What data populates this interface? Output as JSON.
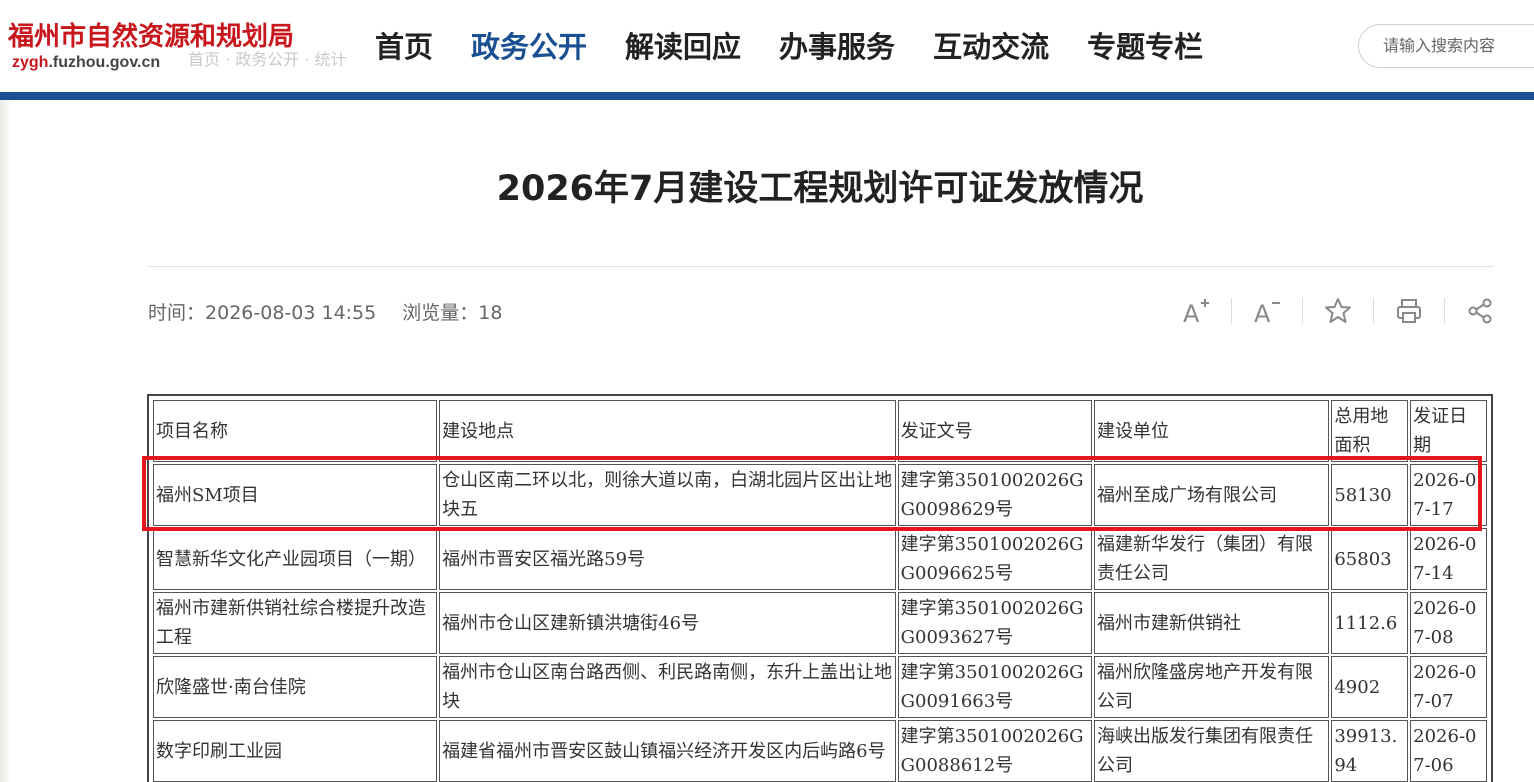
{
  "site": {
    "logo_cn": "福州市自然资源和规划局",
    "logo_en_prefix": "zygh",
    "logo_en_suffix": ".fuzhou.gov.cn",
    "breadcrumb_ghost": "首页 · 政务公开 · 统计"
  },
  "nav": {
    "items": [
      "首页",
      "政务公开",
      "解读回应",
      "办事服务",
      "互动交流",
      "专题专栏"
    ],
    "active_index": 1
  },
  "search": {
    "placeholder": "请输入搜索内容"
  },
  "article": {
    "title": "2026年7月建设工程规划许可证发放情况",
    "time_label": "时间：",
    "time_value": "2026-08-03 14:55",
    "views_label": "浏览量：",
    "views_value": "18"
  },
  "tools": {
    "icons": [
      "font-increase-icon",
      "font-decrease-icon",
      "star-icon",
      "print-icon",
      "share-icon"
    ]
  },
  "colors": {
    "brand_red": "#c8161d",
    "brand_blue": "#1a4f92",
    "highlight": "#e3161e"
  },
  "table": {
    "headers": [
      "项目名称",
      "建设地点",
      "发证文号",
      "建设单位",
      "总用地面积",
      "发证日期"
    ],
    "rows": [
      [
        "福州SM项目",
        "仓山区南二环以北，则徐大道以南，白湖北园片区出让地块五",
        "建字第3501002026GG0098629号",
        "福州至成广场有限公司",
        "58130",
        "2026-07-17"
      ],
      [
        "智慧新华文化产业园项目（一期）",
        "福州市晋安区福光路59号",
        "建字第3501002026GG0096625号",
        "福建新华发行（集团）有限责任公司",
        "65803",
        "2026-07-14"
      ],
      [
        "福州市建新供销社综合楼提升改造工程",
        "福州市仓山区建新镇洪塘街46号",
        "建字第3501002026GG0093627号",
        "福州市建新供销社",
        "1112.6",
        "2026-07-08"
      ],
      [
        "欣隆盛世·南台佳院",
        "福州市仓山区南台路西侧、利民路南侧，东升上盖出让地块",
        "建字第3501002026GG0091663号",
        "福州欣隆盛房地产开发有限公司",
        "4902",
        "2026-07-07"
      ],
      [
        "数字印刷工业园",
        "福建省福州市晋安区鼓山镇福兴经济开发区内后屿路6号",
        "建字第3501002026GG0088612号",
        "海峡出版发行集团有限责任公司",
        "39913.94",
        "2026-07-06"
      ]
    ]
  }
}
